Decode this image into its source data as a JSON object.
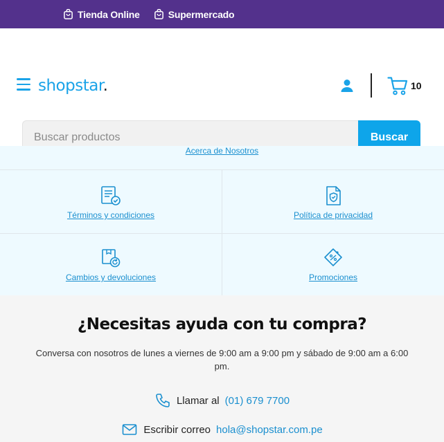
{
  "topbar": {
    "items": [
      {
        "label": "Tienda Online",
        "icon": "shopping-bag-icon"
      },
      {
        "label": "Supermercado",
        "icon": "shopping-bag-icon"
      }
    ],
    "bg_color": "#53318c"
  },
  "header": {
    "logo_text": "shopstar",
    "logo_dot": ".",
    "cart_count": "10",
    "brand_color": "#1aa3e8"
  },
  "search": {
    "placeholder": "Buscar productos",
    "value": "",
    "button_label": "Buscar"
  },
  "links": {
    "about": "Acerca de Nosotros",
    "items": [
      {
        "label": "Términos y condiciones",
        "icon": "document-check-icon"
      },
      {
        "label": "Política de privacidad",
        "icon": "shield-document-icon"
      },
      {
        "label": "Cambios y devoluciones",
        "icon": "return-box-icon"
      },
      {
        "label": "Promociones",
        "icon": "discount-tag-icon"
      }
    ]
  },
  "help": {
    "title": "¿Necesitas ayuda con tu compra?",
    "description": "Conversa con nosotros de lunes a viernes de 9:00 am a 9:00 pm y sábado de 9:00 am a 6:00 pm.",
    "phone_label": "Llamar al",
    "phone_number": "(01) 679 7700",
    "email_label": "Escribir correo",
    "email": "hola@shopstar.com.pe"
  }
}
